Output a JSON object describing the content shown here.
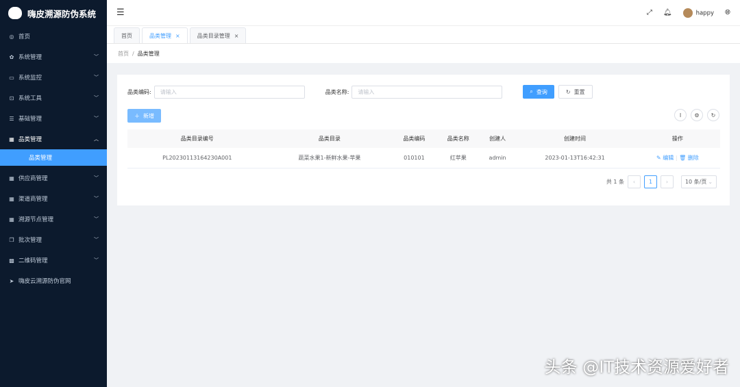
{
  "app": {
    "title": "嗨皮溯源防伪系统"
  },
  "sidebar": {
    "items": [
      {
        "label": "首页",
        "icon": "dashboard-icon",
        "ic": "◎",
        "chev": false
      },
      {
        "label": "系统管理",
        "icon": "gear-icon",
        "ic": "✿",
        "chev": true
      },
      {
        "label": "系统监控",
        "icon": "monitor-icon",
        "ic": "▭",
        "chev": true
      },
      {
        "label": "系统工具",
        "icon": "toolbox-icon",
        "ic": "⊡",
        "chev": true
      },
      {
        "label": "基础管理",
        "icon": "sliders-icon",
        "ic": "☰",
        "chev": true
      },
      {
        "label": "品类管理",
        "icon": "grid-icon",
        "ic": "▦",
        "chev": true,
        "open": true
      },
      {
        "label": "供应商管理",
        "icon": "grid-icon",
        "ic": "▦",
        "chev": true
      },
      {
        "label": "渠道商管理",
        "icon": "grid-icon",
        "ic": "▦",
        "chev": true
      },
      {
        "label": "溯源节点管理",
        "icon": "grid-icon",
        "ic": "▦",
        "chev": true
      },
      {
        "label": "批次管理",
        "icon": "copy-icon",
        "ic": "❐",
        "chev": true
      },
      {
        "label": "二维码管理",
        "icon": "qrcode-icon",
        "ic": "▩",
        "chev": true
      },
      {
        "label": "嗨皮云溯源防伪官网",
        "icon": "send-icon",
        "ic": "➤",
        "chev": false
      }
    ],
    "sub_active": "品类管理"
  },
  "header": {
    "user": "happy"
  },
  "tabs": [
    "首页",
    "品类管理",
    "品类目录管理"
  ],
  "breadcrumb": [
    "首页",
    "品类管理"
  ],
  "form": {
    "code_label": "品类编码:",
    "name_label": "品类名称:",
    "placeholder": "请输入",
    "search": "查询",
    "reset": "重置",
    "add": "新增"
  },
  "table": {
    "headers": [
      "品类目录编号",
      "品类目录",
      "品类编码",
      "品类名称",
      "创建人",
      "创建时间",
      "操作"
    ],
    "rows": [
      [
        "PL20230113164230A001",
        "蔬菜水果1-新鲜水果-苹果",
        "010101",
        "红苹果",
        "admin",
        "2023-01-13T16:42:31"
      ]
    ],
    "edit": "编辑",
    "delete": "删除"
  },
  "pager": {
    "total": "共 1 条",
    "page": "1",
    "size": "10 条/页"
  },
  "watermark": "头条 @IT技术资源爱好者"
}
